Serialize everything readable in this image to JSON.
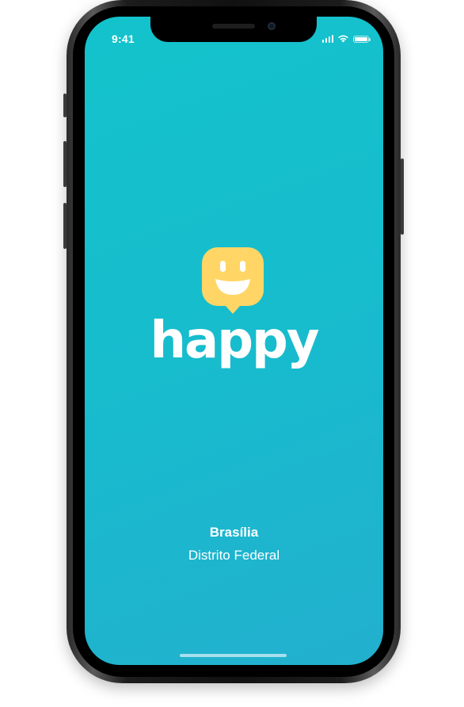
{
  "status_bar": {
    "time": "9:41",
    "icons": [
      "cellular-signal-icon",
      "wifi-icon",
      "battery-icon"
    ]
  },
  "app": {
    "name": "happy",
    "logo_icon": "smiley-chat-bubble-icon",
    "location": {
      "city": "Brasília",
      "state": "Distrito Federal"
    }
  },
  "colors": {
    "background_start": "#13c3cc",
    "background_end": "#22b0cf",
    "logo_yellow": "#ffd666",
    "text": "#ffffff"
  }
}
